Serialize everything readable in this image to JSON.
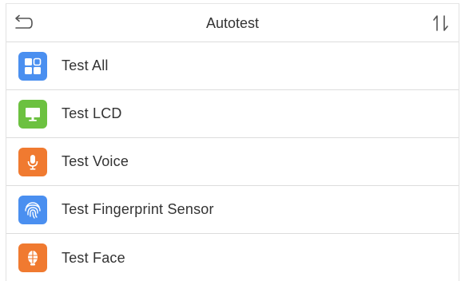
{
  "header": {
    "title": "Autotest",
    "back_icon": "back-arrow-icon",
    "sort_icon": "sort-arrows-icon"
  },
  "items": [
    {
      "label": "Test All",
      "icon": "grid-icon",
      "color": "#4a8ff0"
    },
    {
      "label": "Test LCD",
      "icon": "monitor-icon",
      "color": "#6cc140"
    },
    {
      "label": "Test Voice",
      "icon": "microphone-icon",
      "color": "#f07a30"
    },
    {
      "label": "Test Fingerprint Sensor",
      "icon": "fingerprint-icon",
      "color": "#4a8ff0"
    },
    {
      "label": "Test Face",
      "icon": "face-icon",
      "color": "#f07a30"
    }
  ]
}
